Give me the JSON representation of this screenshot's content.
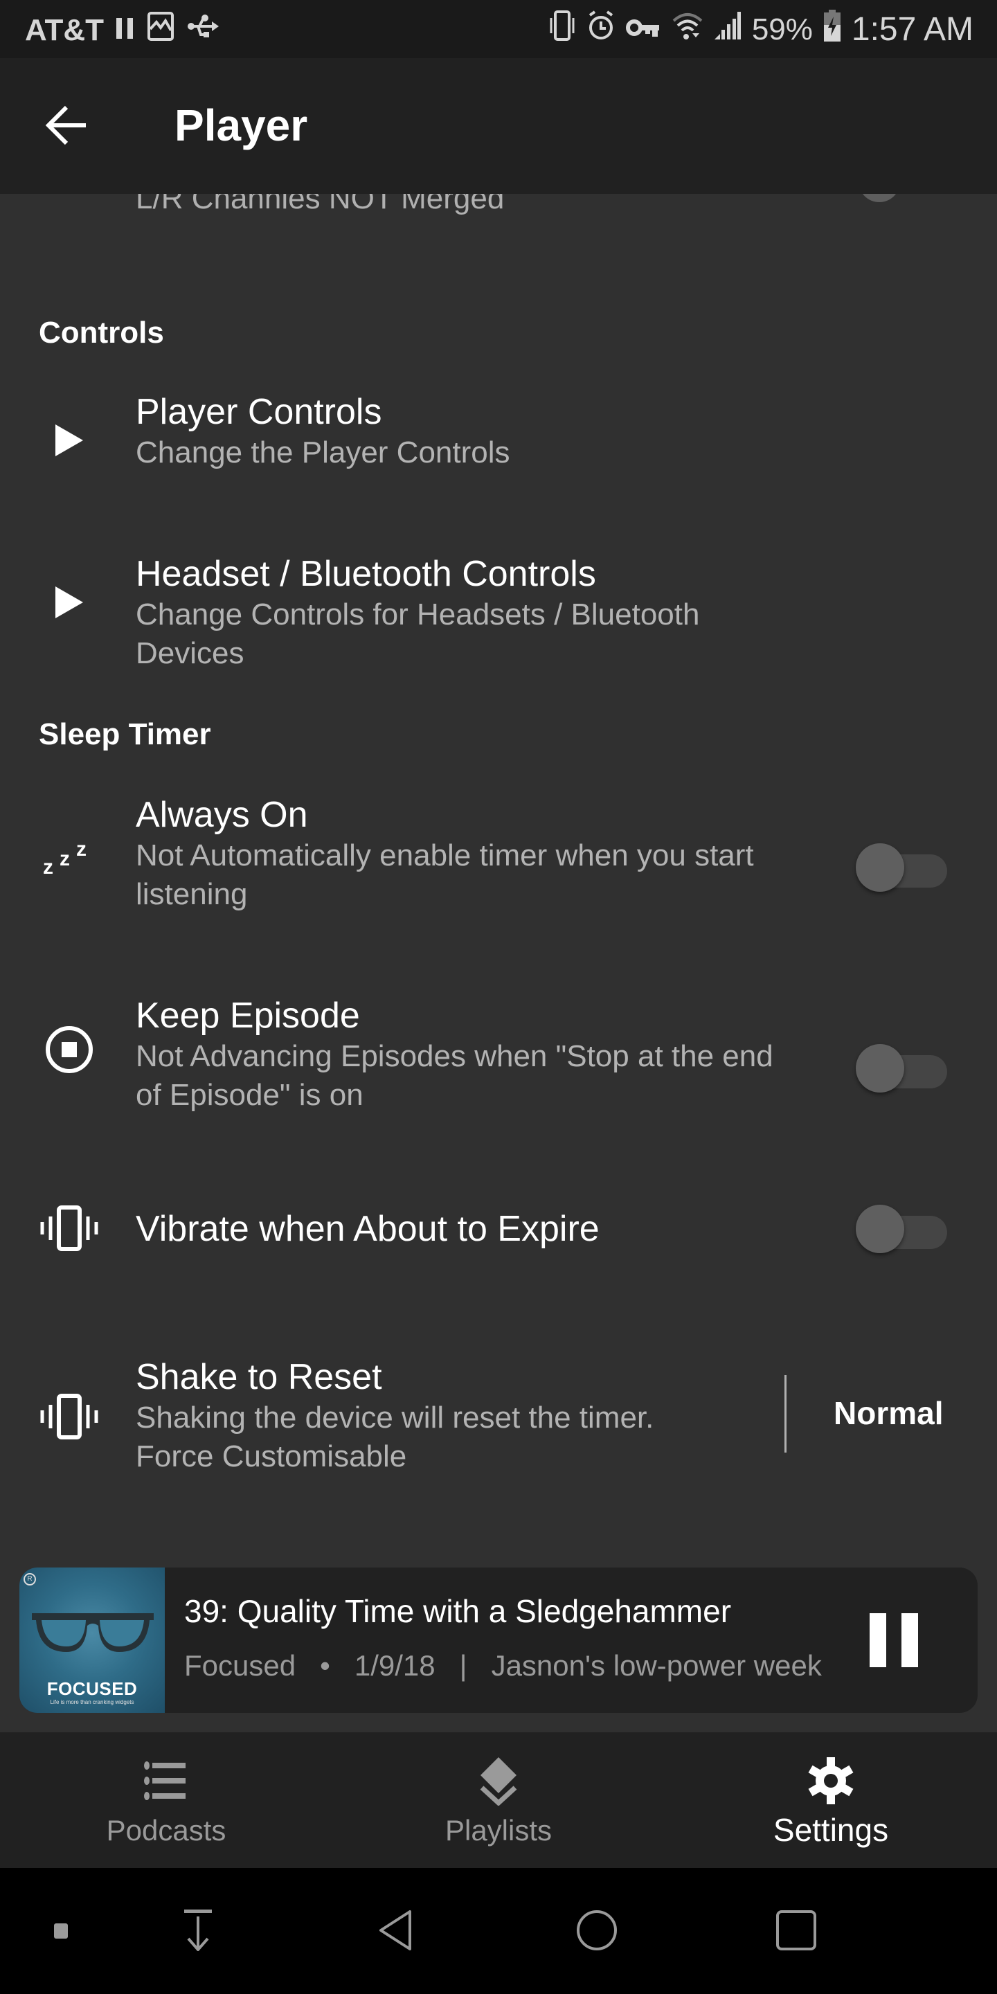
{
  "status_bar": {
    "carrier": "AT&T",
    "left_icons": [
      "signal-bars-icon",
      "image-icon",
      "usb-icon"
    ],
    "right_icons": [
      "vibrate-icon",
      "alarm-icon",
      "vpn-key-icon",
      "wifi-icon",
      "cell-signal-icon"
    ],
    "battery": "59%",
    "time": "1:57 AM"
  },
  "app_bar": {
    "back_icon": "arrow-back-icon",
    "title": "Player"
  },
  "partial_item": {
    "subtitle": "L/R Channles NOT Merged",
    "toggle_on": false
  },
  "sections": {
    "controls": {
      "header": "Controls",
      "items": [
        {
          "icon": "play-icon",
          "title": "Player Controls",
          "subtitle": "Change the Player Controls"
        },
        {
          "icon": "play-icon",
          "title": "Headset / Bluetooth Controls",
          "subtitle": "Change Controls for Headsets / Bluetooth Devices"
        }
      ]
    },
    "sleep_timer": {
      "header": "Sleep Timer",
      "items": [
        {
          "icon": "sleep-zzz-icon",
          "title": "Always On",
          "subtitle": "Not Automatically enable timer when you start listening",
          "toggle_on": false
        },
        {
          "icon": "stop-circle-icon",
          "title": "Keep Episode",
          "subtitle": "Not Advancing Episodes when \"Stop at the end of Episode\" is on",
          "toggle_on": false
        },
        {
          "icon": "vibrate-icon",
          "title": "Vibrate when About to Expire",
          "toggle_on": false
        },
        {
          "icon": "vibrate-icon",
          "title": "Shake to Reset",
          "subtitle": "Shaking the device will reset the timer. Force Customisable",
          "value": "Normal"
        }
      ]
    }
  },
  "mini_player": {
    "artwork": {
      "title": "FOCUSED",
      "tagline": "Life is more than cranking widgets",
      "badge": "R"
    },
    "episode_title": "39: Quality Time with a Sledgehammer",
    "podcast": "Focused",
    "separator_dot": "•",
    "date": "1/9/18",
    "separator_bar": "|",
    "extra": "Jasnon's low-power week",
    "state": "playing",
    "control_icon": "pause-icon"
  },
  "bottom_nav": {
    "items": [
      {
        "label": "Podcasts",
        "icon": "list-icon",
        "active": false
      },
      {
        "label": "Playlists",
        "icon": "layers-icon",
        "active": false
      },
      {
        "label": "Settings",
        "icon": "gear-icon",
        "active": true
      }
    ]
  },
  "system_nav": {
    "buttons": [
      "dot-icon",
      "download-arrow-icon",
      "back-triangle-icon",
      "home-circle-icon",
      "recents-square-icon"
    ]
  }
}
